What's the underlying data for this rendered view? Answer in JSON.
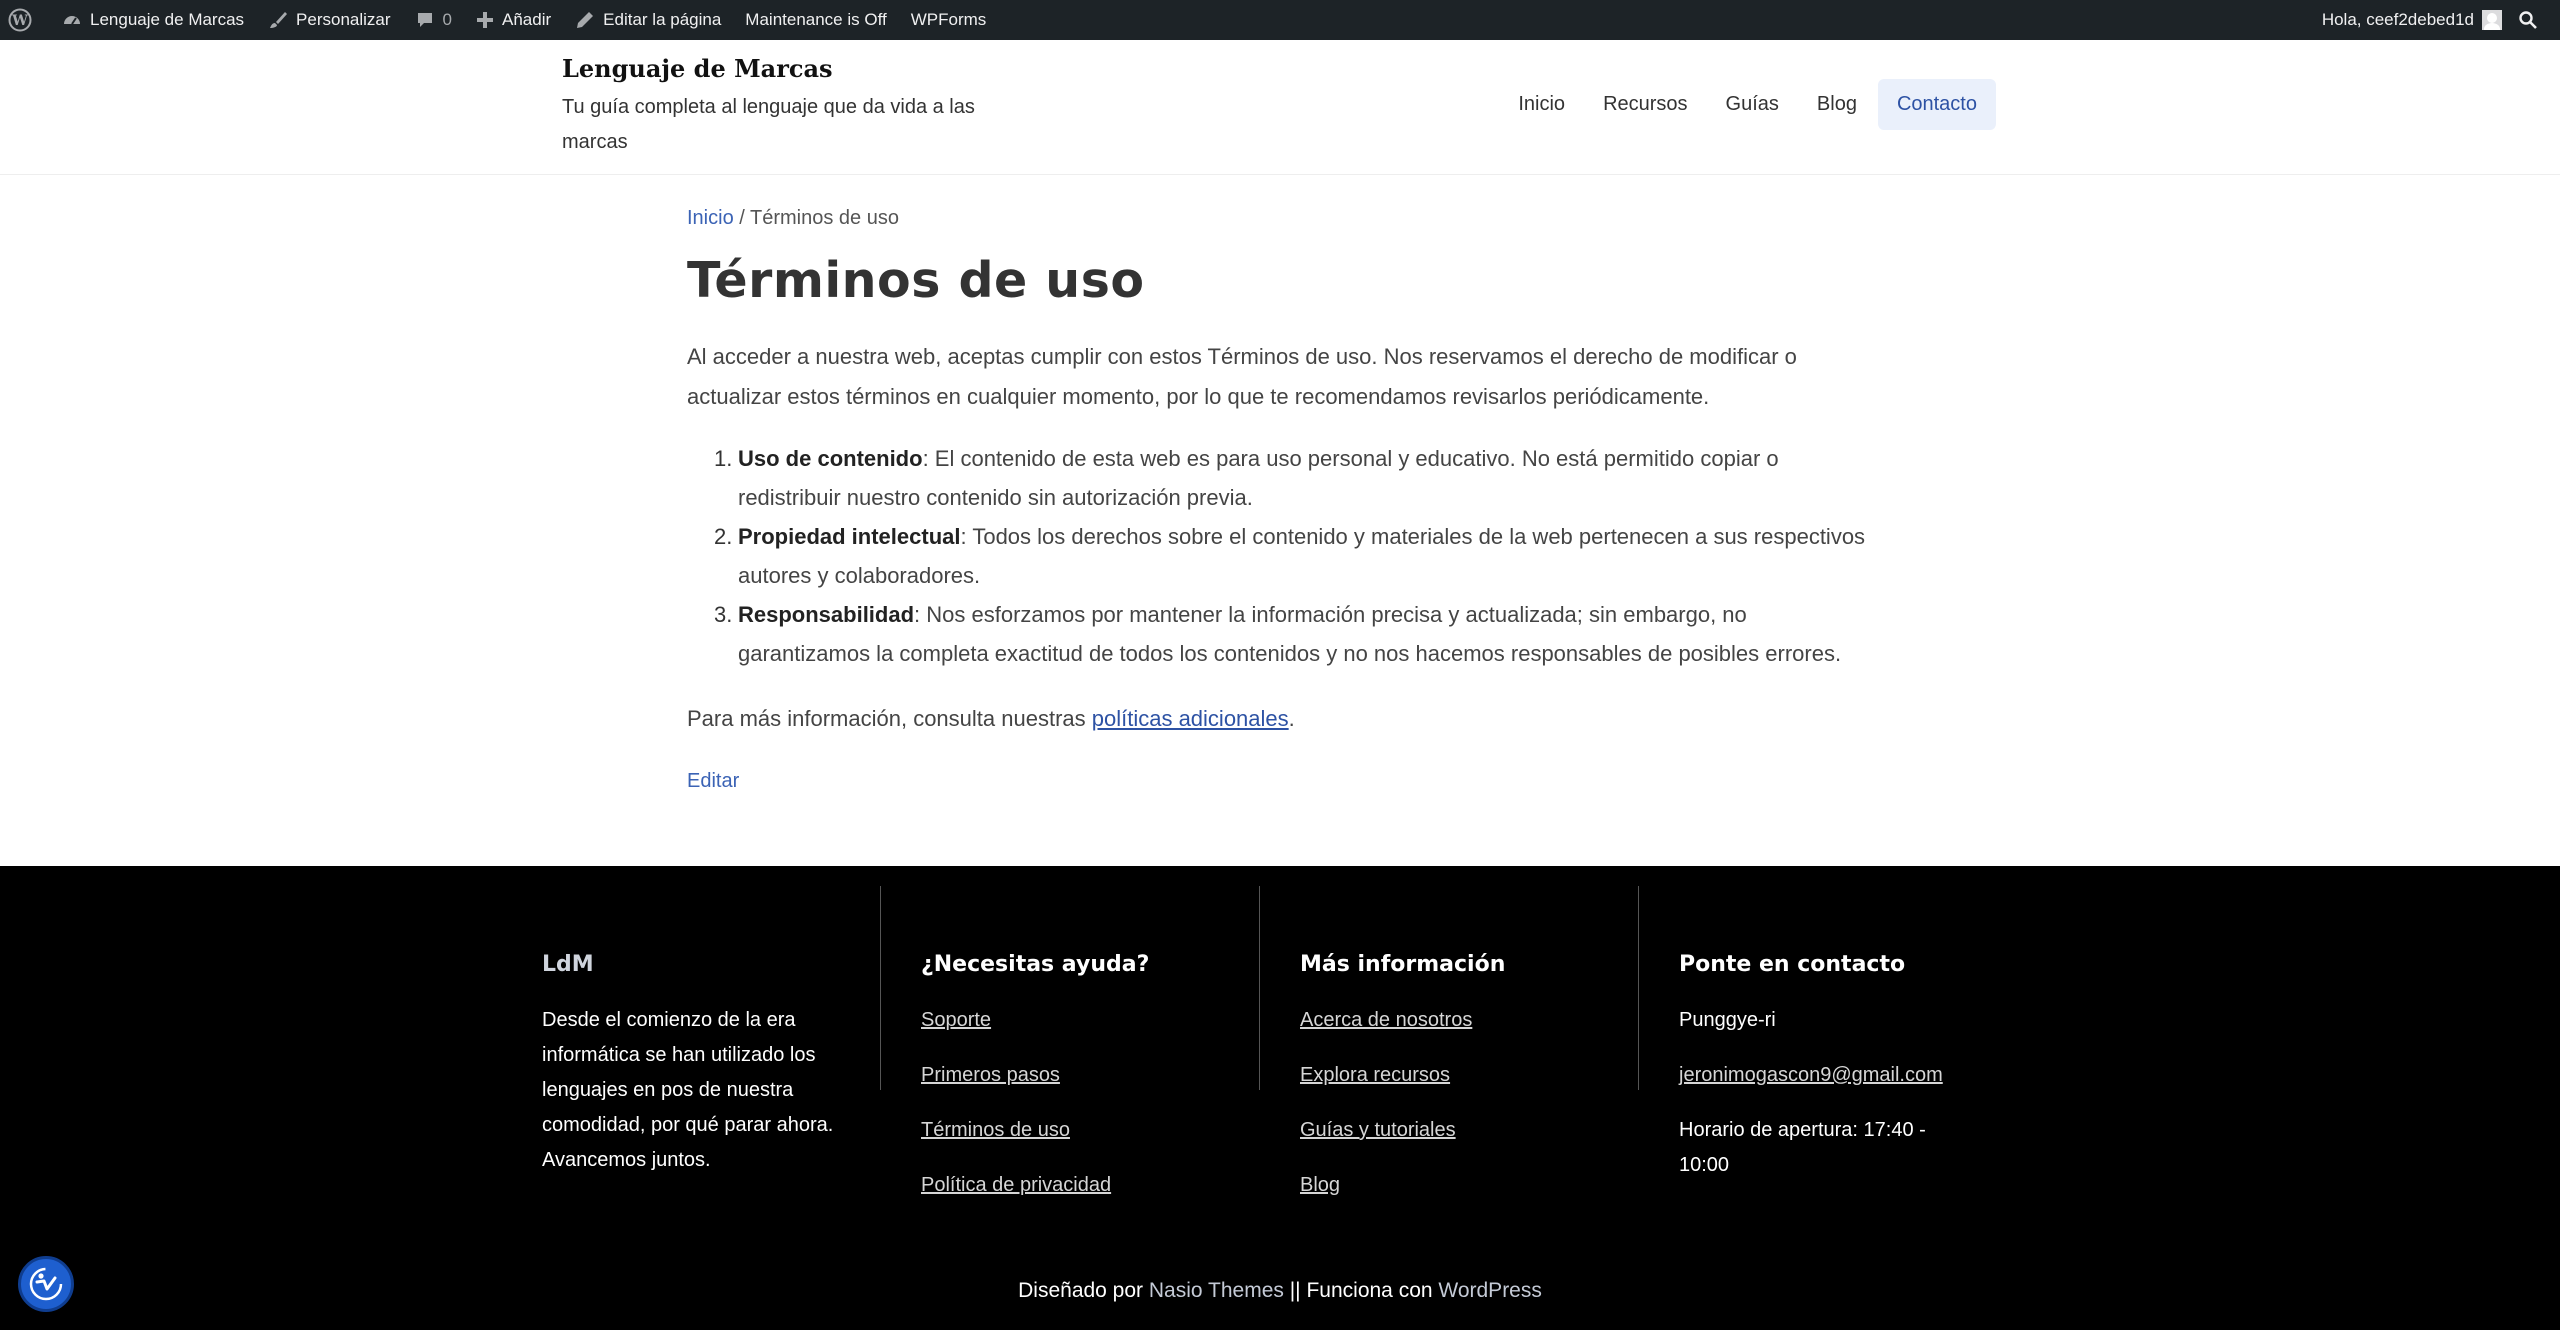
{
  "adminbar": {
    "site_name": "Lenguaje de Marcas",
    "customize": "Personalizar",
    "comments_count": "0",
    "add_new": "Añadir",
    "edit_page": "Editar la página",
    "maintenance": "Maintenance is Off",
    "wpforms": "WPForms",
    "greeting": "Hola, ceef2debed1d"
  },
  "header": {
    "site_title": "Lenguaje de Marcas",
    "tagline": "Tu guía completa al lenguaje que da vida a las marcas",
    "nav": [
      "Inicio",
      "Recursos",
      "Guías",
      "Blog",
      "Contacto"
    ]
  },
  "main": {
    "breadcrumb_home": "Inicio",
    "breadcrumb_sep": " / ",
    "breadcrumb_current": "Términos de uso",
    "title": "Términos de uso",
    "intro": "Al acceder a nuestra web, aceptas cumplir con estos Términos de uso. Nos reservamos el derecho de modificar o actualizar estos términos en cualquier momento, por lo que te recomendamos revisarlos periódicamente.",
    "items": [
      {
        "num": "1.",
        "term": "Uso de contenido",
        "text": ": El contenido de esta web es para uso personal y educativo. No está permitido copiar o redistribuir nuestro contenido sin autorización previa."
      },
      {
        "num": "2.",
        "term": "Propiedad intelectual",
        "text": ": Todos los derechos sobre el contenido y materiales de la web pertenecen a sus respectivos autores y colaboradores."
      },
      {
        "num": "3.",
        "term": "Responsabilidad",
        "text": ": Nos esforzamos por mantener la información precisa y actualizada; sin embargo, no garantizamos la completa exactitud de todos los contenidos y no nos hacemos responsables de posibles errores."
      }
    ],
    "more_prefix": "Para más información, consulta nuestras ",
    "more_link": "políticas adicionales",
    "more_suffix": ".",
    "edit": "Editar"
  },
  "footer": {
    "col1": {
      "heading": "LdM",
      "text": "Desde el comienzo de la era informática se han utilizado los lenguajes en pos de nuestra comodidad, por qué parar ahora. Avancemos juntos."
    },
    "col2": {
      "heading": "¿Necesitas ayuda?",
      "links": [
        "Soporte",
        "Primeros pasos",
        "Términos de uso",
        "Política de privacidad"
      ]
    },
    "col3": {
      "heading": "Más información",
      "links": [
        "Acerca de nosotros",
        "Explora recursos",
        "Guías y tutoriales",
        "Blog"
      ]
    },
    "col4": {
      "heading": "Ponte en contacto",
      "location": "Punggye-ri",
      "email": "jeronimogascon9@gmail.com",
      "hours": "Horario de apertura: 17:40 - 10:00"
    },
    "credits_prefix": "Diseñado por ",
    "credits_theme": "Nasio Themes",
    "credits_mid": " || Funciona con ",
    "credits_wp": "WordPress"
  },
  "colors": {
    "admin_bar": "#1d2327",
    "link": "#2d52a4",
    "footer_bg": "#000000",
    "nav_active_bg": "#eaf0fb"
  },
  "icons": [
    "wordpress-icon",
    "dashboard-icon",
    "brush-icon",
    "comment-icon",
    "plus-icon",
    "pencil-icon",
    "search-icon",
    "accessibility-icon"
  ]
}
